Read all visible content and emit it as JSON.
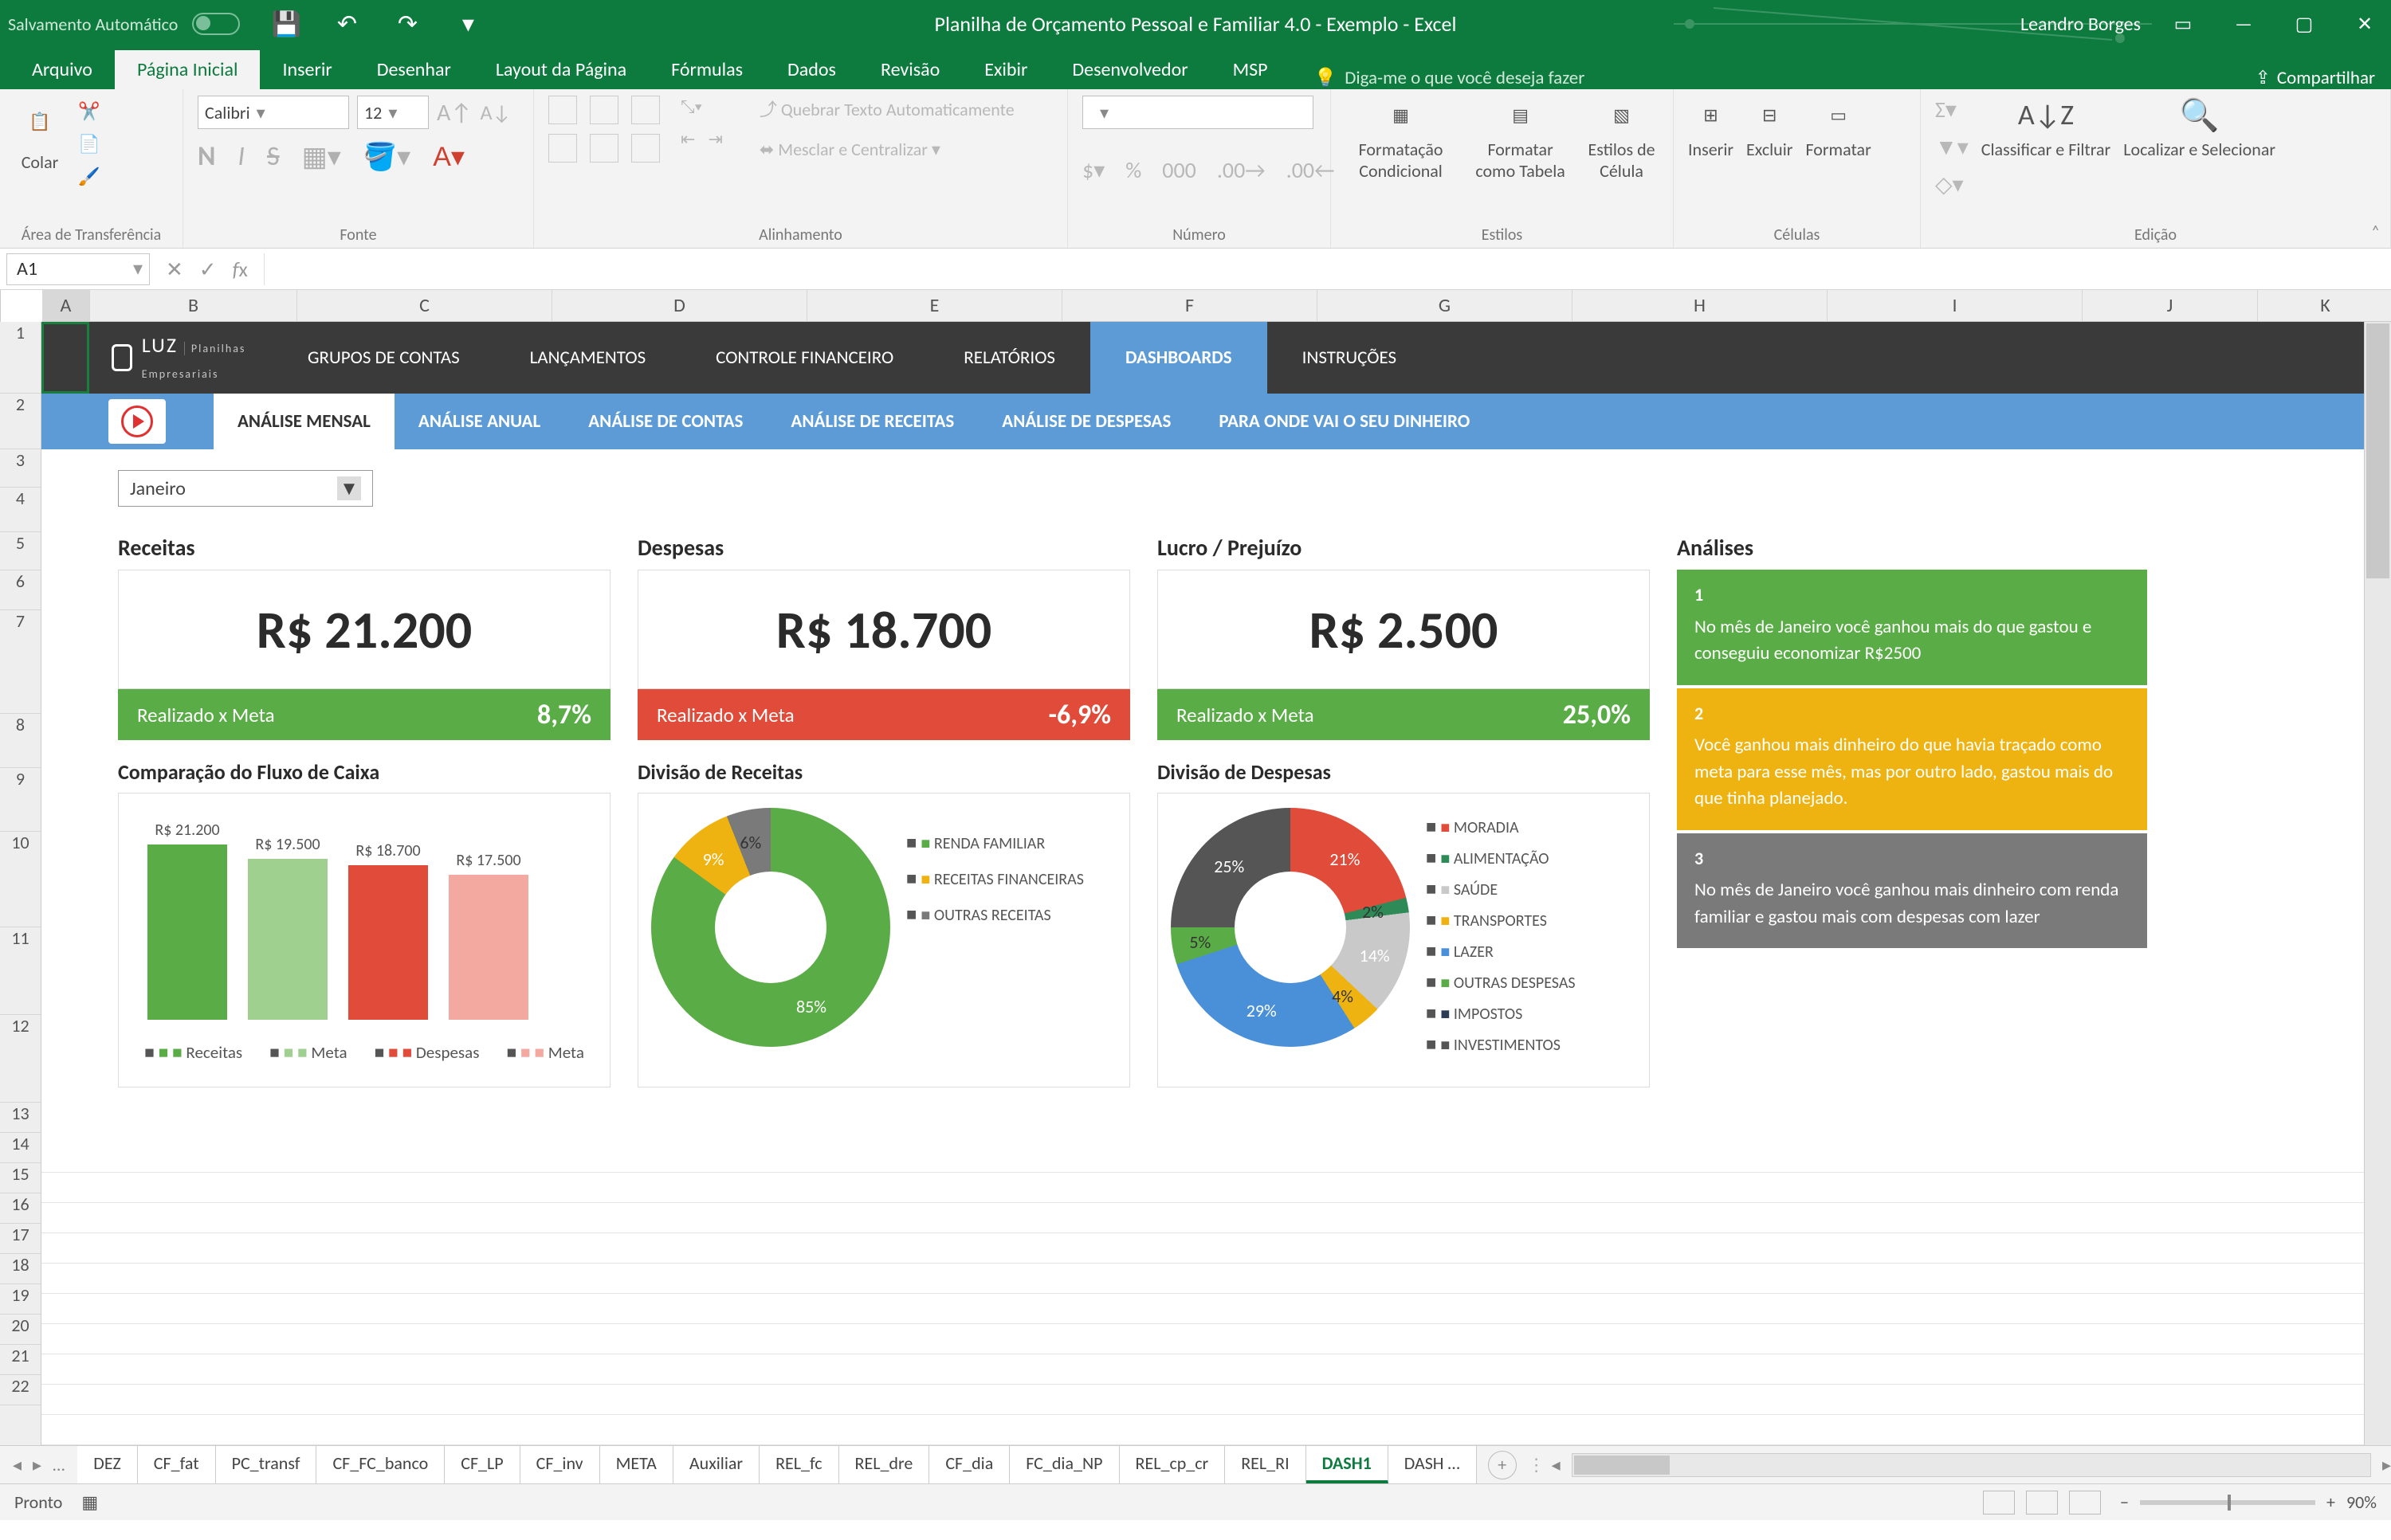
{
  "titlebar": {
    "autosave": "Salvamento Automático",
    "title": "Planilha de Orçamento Pessoal e Familiar 4.0 - Exemplo  -  Excel",
    "user": "Leandro Borges"
  },
  "ribbontabs": {
    "items": [
      "Arquivo",
      "Página Inicial",
      "Inserir",
      "Desenhar",
      "Layout da Página",
      "Fórmulas",
      "Dados",
      "Revisão",
      "Exibir",
      "Desenvolvedor",
      "MSP"
    ],
    "active": 1,
    "tellme": "Diga-me o que você deseja fazer",
    "share": "Compartilhar"
  },
  "ribbon": {
    "clipboard": {
      "paste": "Colar",
      "label": "Área de Transferência"
    },
    "font": {
      "name": "Calibri",
      "size": "12",
      "label": "Fonte"
    },
    "alignment": {
      "wrap": "Quebrar Texto Automaticamente",
      "merge": "Mesclar e Centralizar",
      "label": "Alinhamento"
    },
    "number": {
      "label": "Número"
    },
    "styles": {
      "cond": "Formatação Condicional",
      "table": "Formatar como Tabela",
      "cell": "Estilos de Célula",
      "label": "Estilos"
    },
    "cells": {
      "insert": "Inserir",
      "delete": "Excluir",
      "format": "Formatar",
      "label": "Células"
    },
    "editing": {
      "sort": "Classificar e Filtrar",
      "find": "Localizar e Selecionar",
      "label": "Edição"
    }
  },
  "formula": {
    "cell": "A1"
  },
  "columns": [
    "A",
    "B",
    "C",
    "D",
    "E",
    "F",
    "G",
    "H",
    "I",
    "J",
    "K"
  ],
  "rows": [
    "1",
    "2",
    "3",
    "4",
    "5",
    "6",
    "7",
    "8",
    "9",
    "10",
    "11",
    "12",
    "13",
    "14",
    "15",
    "16",
    "17",
    "18",
    "19",
    "20",
    "21",
    "22"
  ],
  "nav": {
    "logo_a": "LUZ",
    "logo_b": "Planilhas Empresariais",
    "items": [
      "GRUPOS DE CONTAS",
      "LANÇAMENTOS",
      "CONTROLE FINANCEIRO",
      "RELATÓRIOS",
      "DASHBOARDS",
      "INSTRUÇÕES"
    ],
    "active": 4
  },
  "subnav": {
    "items": [
      "ANÁLISE MENSAL",
      "ANÁLISE ANUAL",
      "ANÁLISE DE CONTAS",
      "ANÁLISE DE RECEITAS",
      "ANÁLISE DE DESPESAS",
      "PARA ONDE VAI O SEU DINHEIRO"
    ],
    "active": 0
  },
  "month": "Janeiro",
  "kpi": {
    "receitas": {
      "title": "Receitas",
      "value": "R$ 21.200",
      "meta_label": "Realizado x Meta",
      "pct": "8,7%",
      "color": "green"
    },
    "despesas": {
      "title": "Despesas",
      "value": "R$ 18.700",
      "meta_label": "Realizado x Meta",
      "pct": "-6,9%",
      "color": "red"
    },
    "lucro": {
      "title": "Lucro / Prejuízo",
      "value": "R$ 2.500",
      "meta_label": "Realizado x Meta",
      "pct": "25,0%",
      "color": "green"
    }
  },
  "analises": {
    "title": "Análises",
    "items": [
      {
        "n": "1",
        "text": "No mês de Janeiro você ganhou mais do que gastou e conseguiu economizar R$2500",
        "cls": "an-green"
      },
      {
        "n": "2",
        "text": "Você ganhou mais dinheiro do que havia traçado como meta para esse mês, mas por outro lado, gastou mais do que tinha planejado.",
        "cls": "an-yellow"
      },
      {
        "n": "3",
        "text": "No mês de Janeiro você ganhou mais dinheiro com renda familiar e gastou mais com despesas com lazer",
        "cls": "an-gray"
      }
    ]
  },
  "chart_data": [
    {
      "id": "fluxo",
      "title": "Comparação do Fluxo de Caixa",
      "type": "bar",
      "categories": [
        "Receitas",
        "Meta",
        "Despesas",
        "Meta"
      ],
      "values": [
        21200,
        19500,
        18700,
        17500
      ],
      "value_labels": [
        "R$ 21.200",
        "R$ 19.500",
        "R$ 18.700",
        "R$ 17.500"
      ],
      "colors": [
        "#5aad46",
        "#9fd08f",
        "#e04b3a",
        "#f3a99f"
      ],
      "legend": [
        "Receitas",
        "Meta",
        "Despesas",
        "Meta"
      ]
    },
    {
      "id": "div_receitas",
      "title": "Divisão de Receitas",
      "type": "pie",
      "series": [
        {
          "name": "RENDA FAMILIAR",
          "value": 85,
          "color": "#5aad46"
        },
        {
          "name": "RECEITAS FINANCEIRAS",
          "value": 9,
          "color": "#eeb211"
        },
        {
          "name": "OUTRAS RECEITAS",
          "value": 6,
          "color": "#7a7a7a"
        }
      ]
    },
    {
      "id": "div_despesas",
      "title": "Divisão de Despesas",
      "type": "pie",
      "series": [
        {
          "name": "MORADIA",
          "value": 21,
          "color": "#e04b3a"
        },
        {
          "name": "ALIMENTAÇÃO",
          "value": 2,
          "color": "#2e8b57"
        },
        {
          "name": "SAÚDE",
          "value": 14,
          "color": "#c9c9c9"
        },
        {
          "name": "TRANSPORTES",
          "value": 4,
          "color": "#eeb211"
        },
        {
          "name": "LAZER",
          "value": 29,
          "color": "#4a90d9"
        },
        {
          "name": "OUTRAS DESPESAS",
          "value": 5,
          "color": "#5aad46"
        },
        {
          "name": "IMPOSTOS",
          "value": 0,
          "color": "#2b3a55"
        },
        {
          "name": "INVESTIMENTOS",
          "value": 25,
          "color": "#555555"
        }
      ]
    }
  ],
  "sheettabs": {
    "items": [
      "DEZ",
      "CF_fat",
      "PC_transf",
      "CF_FC_banco",
      "CF_LP",
      "CF_inv",
      "META",
      "Auxiliar",
      "REL_fc",
      "REL_dre",
      "CF_dia",
      "FC_dia_NP",
      "REL_cp_cr",
      "REL_RI",
      "DASH1",
      "DASH …"
    ],
    "active": 14
  },
  "status": {
    "ready": "Pronto",
    "zoom": "90%"
  }
}
